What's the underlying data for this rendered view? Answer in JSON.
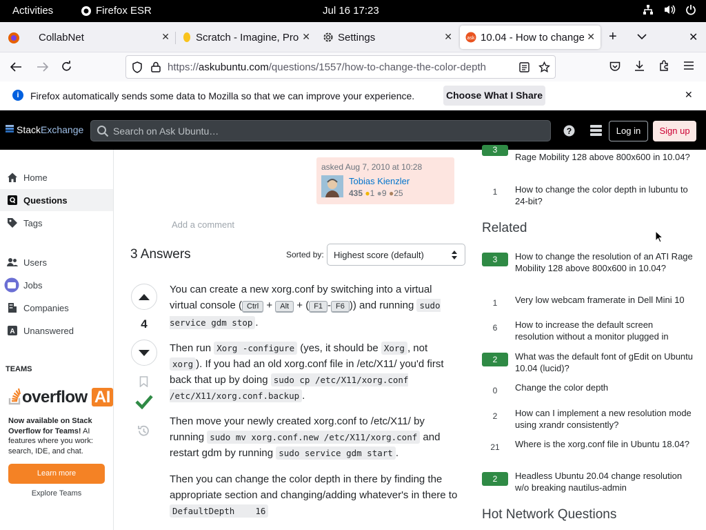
{
  "system": {
    "activities": "Activities",
    "app_name": "Firefox ESR",
    "clock": "Jul 16  17:23"
  },
  "tabs": [
    {
      "title": "CollabNet"
    },
    {
      "title": "Scratch - Imagine, Prog"
    },
    {
      "title": "Settings"
    },
    {
      "title": "10.04 - How to change"
    }
  ],
  "url": {
    "prefix": "https://",
    "domain": "askubuntu.com",
    "path": "/questions/1557/how-to-change-the-color-depth"
  },
  "notification": {
    "message": "Firefox automatically sends some data to Mozilla so that we can improve your experience.",
    "button": "Choose What I Share"
  },
  "header": {
    "logo_a": "Stack",
    "logo_b": "Exchange",
    "search_placeholder": "Search on Ask Ubuntu…",
    "login": "Log in",
    "signup": "Sign up"
  },
  "leftnav": {
    "items": [
      "Home",
      "Questions",
      "Tags",
      "Users",
      "Jobs",
      "Companies",
      "Unanswered"
    ],
    "teams": "TEAMS",
    "brand_a": "overflow",
    "brand_b": "AI",
    "promo_bold": "Now available on Stack Overflow for Teams!",
    "promo_rest": " AI features where you work: search, IDE, and chat.",
    "learn": "Learn more",
    "explore": "Explore Teams"
  },
  "question": {
    "asked": "asked Aug 7, 2010 at 10:28",
    "user": "Tobias Kienzler",
    "rep": "435",
    "gold": "1",
    "silver": "9",
    "bronze": "25",
    "add_comment": "Add a comment"
  },
  "answers": {
    "heading": "3 Answers",
    "sorted_by": "Sorted by:",
    "sort_value": "Highest score (default)",
    "score": "4"
  },
  "answer": {
    "p1a": "You can create a new xorg.conf by switching into a virtual virtual console (",
    "k1": "Ctrl",
    "plus1": " + ",
    "k2": "Alt",
    "p1b": " + (",
    "k3": "F1",
    "dash": "-",
    "k4": "F6",
    "p1c": ")) and running ",
    "c1": "sudo service gdm stop",
    "p1d": ".",
    "p2a": "Then run ",
    "c2": "Xorg -configure",
    "p2b": " (yes, it should be ",
    "c3": "Xorg",
    "p2c": ", not ",
    "c4": "xorg",
    "p2d": "). If you had an old xorg.conf file in /etc/X11/ you'd first back that up by doing ",
    "c5": "sudo cp /etc/X11/xorg.conf /etc/X11/xorg.conf.backup",
    "p2e": ".",
    "p3a": "Then move your newly created xorg.conf to /etc/X11/ by running ",
    "c6": "sudo mv xorg.conf.new /etc/X11/xorg.conf",
    "p3b": " and restart gdm by running ",
    "c7": "sudo service gdm start",
    "p3c": ".",
    "p4a": "Then you can change the color depth in there by finding the appropriate section and changing/adding whatever's in there to ",
    "c8": "DefaultDepth    16"
  },
  "linked_partial": [
    {
      "count": "3",
      "title": "Rage Mobility 128 above 800x600 in 10.04?"
    },
    {
      "count": "1",
      "title": "How to change the color depth in lubuntu to 24-bit?"
    }
  ],
  "related_heading": "Related",
  "related": [
    {
      "count": "3",
      "answered": true,
      "title": "How to change the resolution of an ATI Rage Mobility 128 above 800x600 in 10.04?"
    },
    {
      "count": "1",
      "answered": false,
      "title": "Very low webcam framerate in Dell Mini 10"
    },
    {
      "count": "6",
      "answered": false,
      "title": "How to increase the default screen resolution without a monitor plugged in"
    },
    {
      "count": "2",
      "answered": true,
      "title": "What was the default font of gEdit on Ubuntu 10.04 (lucid)?"
    },
    {
      "count": "0",
      "answered": false,
      "title": "Change the color depth"
    },
    {
      "count": "2",
      "answered": false,
      "title": "How can I implement a new resolution mode using xrandr consistently?"
    },
    {
      "count": "21",
      "answered": false,
      "title": "Where is the xorg.conf file in Ubuntu 18.04?"
    },
    {
      "count": "2",
      "answered": true,
      "title": "Headless Ubuntu 20.04 change resolution w/o breaking nautilus-admin"
    }
  ],
  "hot_heading": "Hot Network Questions"
}
